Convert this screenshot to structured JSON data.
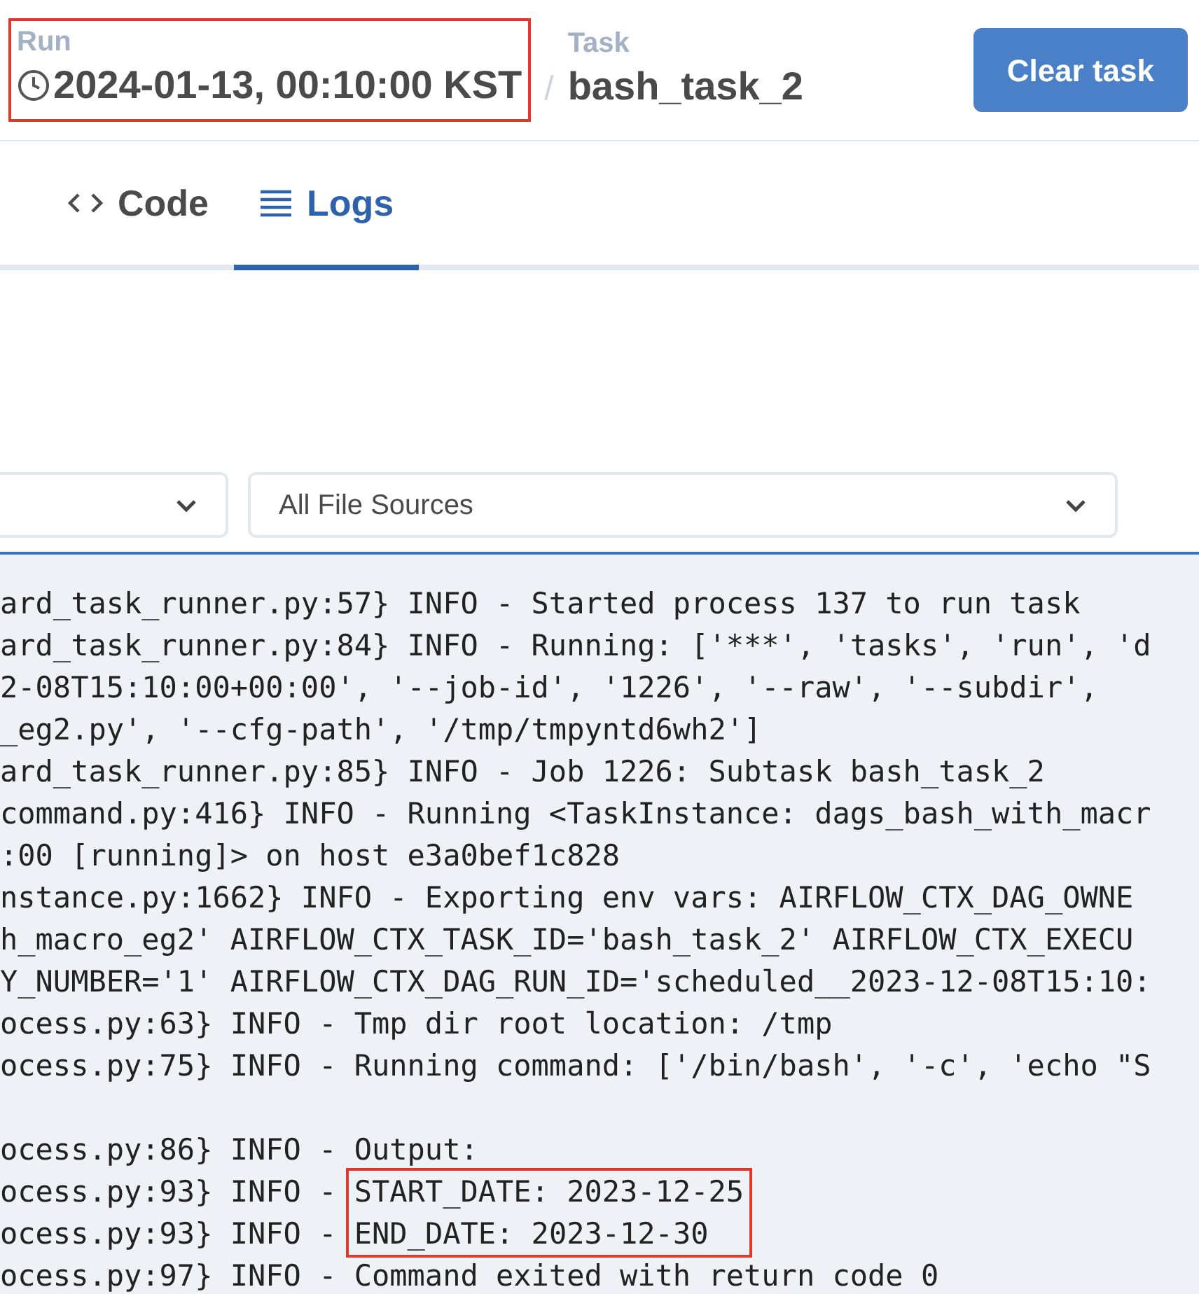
{
  "header": {
    "run_label": "Run",
    "run_value": "2024-01-13, 00:10:00 KST",
    "separator": "/",
    "task_label": "Task",
    "task_value": "bash_task_2",
    "run_marked": true,
    "button": "Clear task"
  },
  "tabs": [
    {
      "label": "Code",
      "kind": "code",
      "selected": false
    },
    {
      "label": "Logs",
      "kind": "list",
      "selected": true
    }
  ],
  "filters": [
    {
      "kind": "select"
    },
    {
      "kind": "select",
      "value": "All File Sources"
    }
  ],
  "log": [
    {
      "kind": "line",
      "text": "ard_task_runner.py:57} INFO - Started process 137 to run task"
    },
    {
      "kind": "line",
      "text": "ard_task_runner.py:84} INFO - Running: ['***', 'tasks', 'run', 'd"
    },
    {
      "kind": "line",
      "text": "2-08T15:10:00+00:00', '--job-id', '1226', '--raw', '--subdir',"
    },
    {
      "kind": "line",
      "text": "_eg2.py', '--cfg-path', '/tmp/tmpyntd6wh2']"
    },
    {
      "kind": "line",
      "text": "ard_task_runner.py:85} INFO - Job 1226: Subtask bash_task_2"
    },
    {
      "kind": "line",
      "text": "command.py:416} INFO - Running <TaskInstance: dags_bash_with_macr"
    },
    {
      "kind": "line",
      "text": ":00 [running]> on host e3a0bef1c828"
    },
    {
      "kind": "line",
      "text": "nstance.py:1662} INFO - Exporting env vars: AIRFLOW_CTX_DAG_OWNE"
    },
    {
      "kind": "line",
      "text": "h_macro_eg2' AIRFLOW_CTX_TASK_ID='bash_task_2' AIRFLOW_CTX_EXECU"
    },
    {
      "kind": "line",
      "text": "Y_NUMBER='1' AIRFLOW_CTX_DAG_RUN_ID='scheduled__2023-12-08T15:10:"
    },
    {
      "kind": "line",
      "text": "ocess.py:63} INFO - Tmp dir root location: /tmp"
    },
    {
      "kind": "line",
      "text": "ocess.py:75} INFO - Running command: ['/bin/bash', '-c', 'echo \"S"
    },
    {
      "kind": "blank"
    },
    {
      "kind": "line",
      "text": "ocess.py:86} INFO - Output:"
    },
    {
      "kind": "marked",
      "prefixes": [
        "ocess.py:93} INFO - ",
        "ocess.py:93} INFO - "
      ],
      "marked": [
        "START_DATE: 2023-12-25",
        "END_DATE: 2023-12-30"
      ]
    },
    {
      "kind": "line",
      "text": "ocess.py:97} INFO - Command exited with return code 0"
    }
  ]
}
